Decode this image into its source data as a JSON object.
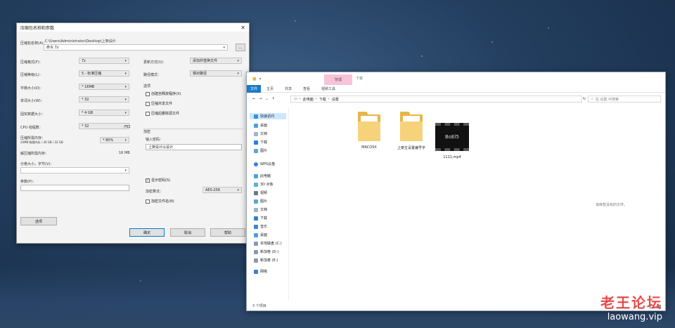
{
  "dialog": {
    "title": "压缩包名称和参数",
    "archive_label": "压缩包名称(A)：",
    "archive_path": "C:\\Users\\Administrator\\Desktop\\上架设计",
    "archive_name": "命令.7z",
    "left_fields": [
      {
        "label": "压缩格式(F)：",
        "value": "7z"
      },
      {
        "label": "压缩等级(L)：",
        "value": "5 - 标准压缩"
      },
      {
        "label": "字典大小(D)：",
        "value": "* 16MB"
      },
      {
        "label": "单词大小(W)：",
        "value": "* 32"
      },
      {
        "label": "固实数据大小：",
        "value": "* 4 GB"
      },
      {
        "label": "CPU 线程数：",
        "value": "* 32"
      }
    ],
    "cpu_threads_max": "/ 32",
    "memory_label": "压缩所需内存：",
    "memory_sub": "24MB 物理内存 / 30 GB / 32 GB",
    "memory_percent": "* 80%",
    "decompress_mem_label": "解压缩所需内存：",
    "decompress_mem_value": "16 MB",
    "split_label": "分卷大小，字节(V)：",
    "params_label": "参数(P)：",
    "options_button": "选项",
    "update_mode_label": "更新方式(U)：",
    "update_mode_value": "添加并替换文件",
    "path_mode_label": "路径模式：",
    "path_mode_value": "相对路径",
    "options_group": "选项",
    "opt_sfx": "创建自释放程序(X)",
    "opt_shared": "压缩共享文件",
    "opt_delete": "压缩后删除源文件",
    "encrypt_group": "加密",
    "password_label": "输入密码：",
    "password_value": "上架设计以设计",
    "show_password": "显示密码(S)",
    "encrypt_method_label": "加密算法：",
    "encrypt_method_value": "AES-256",
    "encrypt_names": "加密文件名(N)",
    "ok_button": "确定",
    "cancel_button": "取消",
    "help_button": "帮助"
  },
  "explorer": {
    "context_tab": "管理",
    "context_label": "下载",
    "ribbon": {
      "file": "文件",
      "tabs": [
        "主页",
        "共享",
        "查看",
        "视频工具"
      ]
    },
    "path": [
      "此电脑",
      "下载",
      "设置"
    ],
    "search_placeholder": "在 设置 中搜索",
    "nav": {
      "quick_access": "快速访问",
      "quick_items": [
        "桌面",
        "文档",
        "下载",
        "图片"
      ],
      "wps": "WPS云盘",
      "this_pc": "此电脑",
      "pc_items": [
        "3D 对象",
        "视频",
        "图片",
        "文档",
        "下载",
        "音乐",
        "桌面",
        "本地磁盘 (C:)",
        "新加卷 (D:)",
        "新加卷 (E:)"
      ],
      "network": "网络"
    },
    "files": [
      {
        "name": "MACOSX",
        "type": "folder"
      },
      {
        "name": "上架主设置编号字",
        "type": "folder"
      },
      {
        "name": "1111.mp4",
        "type": "video",
        "thumb_text": "BoEl5"
      }
    ],
    "empty_message": "该库暂没有的文件。",
    "status": "3 个项目"
  },
  "watermark": {
    "cn": "老王论坛",
    "en": "laowang.vip"
  }
}
